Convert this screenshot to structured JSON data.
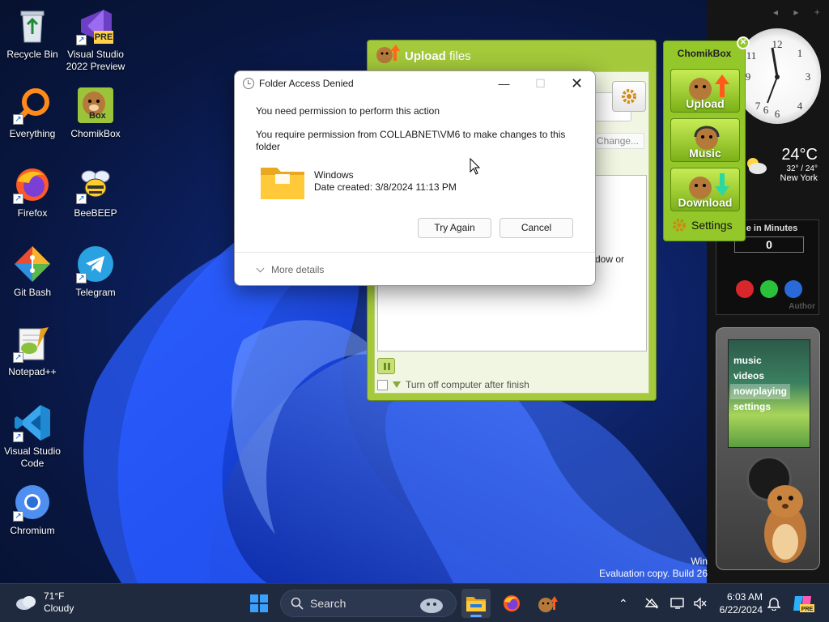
{
  "desktop": {
    "icons": [
      {
        "label": "Recycle Bin"
      },
      {
        "label": "Visual Studio 2022 Preview"
      },
      {
        "label": "Everything"
      },
      {
        "label": "ChomikBox"
      },
      {
        "label": "Firefox"
      },
      {
        "label": "BeeBEEP"
      },
      {
        "label": "Git Bash"
      },
      {
        "label": "Telegram"
      },
      {
        "label": "Notepad++"
      },
      {
        "label": "Visual Studio Code"
      },
      {
        "label": "Chromium"
      }
    ],
    "vs_badge": "PRE",
    "chomikbox_badge": "Box"
  },
  "upload_window": {
    "title_bold": "Upload",
    "title_rest": " files",
    "change_label": "Change...",
    "list_fragment": "dow or",
    "turn_off_label": "Turn off computer after finish"
  },
  "dialog": {
    "title": "Folder Access Denied",
    "message1": "You need permission to perform this action",
    "message2": "You require permission from COLLABNET\\VM6 to make changes to this folder",
    "folder_name": "Windows",
    "folder_date": "Date created: 3/8/2024 11:13 PM",
    "try_again": "Try Again",
    "cancel": "Cancel",
    "more_details": "More details"
  },
  "chomikbox_gadget": {
    "title": "ChomikBox",
    "upload": "Upload",
    "music": "Music",
    "download": "Download",
    "settings": "Settings"
  },
  "gadgets": {
    "weather_temp": "24°C",
    "weather_range": "32° / 24°",
    "weather_city": "New York",
    "timer_label": "ne in Minutes",
    "timer_value": "0",
    "timer_author": "Author",
    "zune_menu": [
      "music",
      "videos",
      "nowplaying",
      "settings"
    ]
  },
  "watermark": {
    "line1": "Win",
    "line2": "Evaluation copy. Build 26"
  },
  "taskbar": {
    "weather_temp": "71°F",
    "weather_cond": "Cloudy",
    "search_placeholder": "Search",
    "time": "6:03 AM",
    "date": "6/22/2024"
  },
  "colors": {
    "chomik_green": "#a4c93a",
    "taskbar_bg": "#1f2a3e",
    "accent": "#60a8ff"
  }
}
